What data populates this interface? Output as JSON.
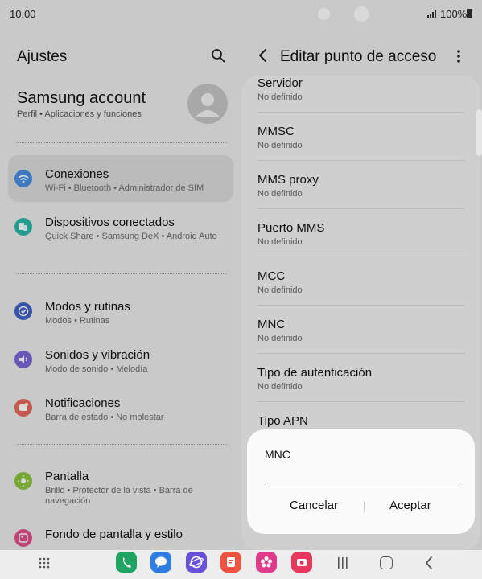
{
  "status": {
    "time": "10.00",
    "battery": "100%"
  },
  "left": {
    "title": "Ajustes",
    "account": {
      "title": "Samsung account",
      "subtitle": "Perfil  •  Aplicaciones y funciones"
    },
    "items": [
      {
        "label": "Conexiones",
        "sub": "Wi-Fi  •  Bluetooth  •  Administrador de SIM",
        "icon": "wifi-icon",
        "color": "#4a90e2",
        "active": true
      },
      {
        "label": "Dispositivos conectados",
        "sub": "Quick Share  •  Samsung DeX  •  Android Auto",
        "icon": "devices-icon",
        "color": "#2ab7a9"
      },
      {
        "label": "Modos y rutinas",
        "sub": "Modos  •  Rutinas",
        "icon": "check-circle-icon",
        "color": "#3f62c6"
      },
      {
        "label": "Sonidos y vibración",
        "sub": "Modo de sonido  •  Melodía",
        "icon": "speaker-icon",
        "color": "#7c67d8"
      },
      {
        "label": "Notificaciones",
        "sub": "Barra de estado  •  No molestar",
        "icon": "bell-icon",
        "color": "#e8685b"
      },
      {
        "label": "Pantalla",
        "sub": "Brillo  •  Protector de la vista  •  Barra de navegación",
        "icon": "sun-icon",
        "color": "#8cc63f"
      },
      {
        "label": "Fondo de pantalla y estilo",
        "sub": "",
        "icon": "image-icon",
        "color": "#e0508a"
      }
    ]
  },
  "right": {
    "title": "Editar punto de acceso",
    "fields": [
      {
        "label": "Servidor",
        "value": "No definido"
      },
      {
        "label": "MMSC",
        "value": "No definido"
      },
      {
        "label": "MMS proxy",
        "value": "No definido"
      },
      {
        "label": "Puerto MMS",
        "value": "No definido"
      },
      {
        "label": "MCC",
        "value": "No definido"
      },
      {
        "label": "MNC",
        "value": "No definido"
      },
      {
        "label": "Tipo de autenticación",
        "value": "No definido"
      },
      {
        "label": "Tipo APN",
        "value": ""
      }
    ]
  },
  "dialog": {
    "title": "MNC",
    "value": "",
    "cancel": "Cancelar",
    "accept": "Aceptar"
  },
  "dock": {
    "apps": [
      {
        "name": "phone-app-icon",
        "color": "#1fa463"
      },
      {
        "name": "messages-app-icon",
        "color": "#2f7de1"
      },
      {
        "name": "internet-app-icon",
        "color": "#6a4fd8"
      },
      {
        "name": "notes-app-icon",
        "color": "#f0533f"
      },
      {
        "name": "gallery-app-icon",
        "color": "#e03b8a"
      },
      {
        "name": "camera-app-icon",
        "color": "#e8365d"
      }
    ]
  }
}
